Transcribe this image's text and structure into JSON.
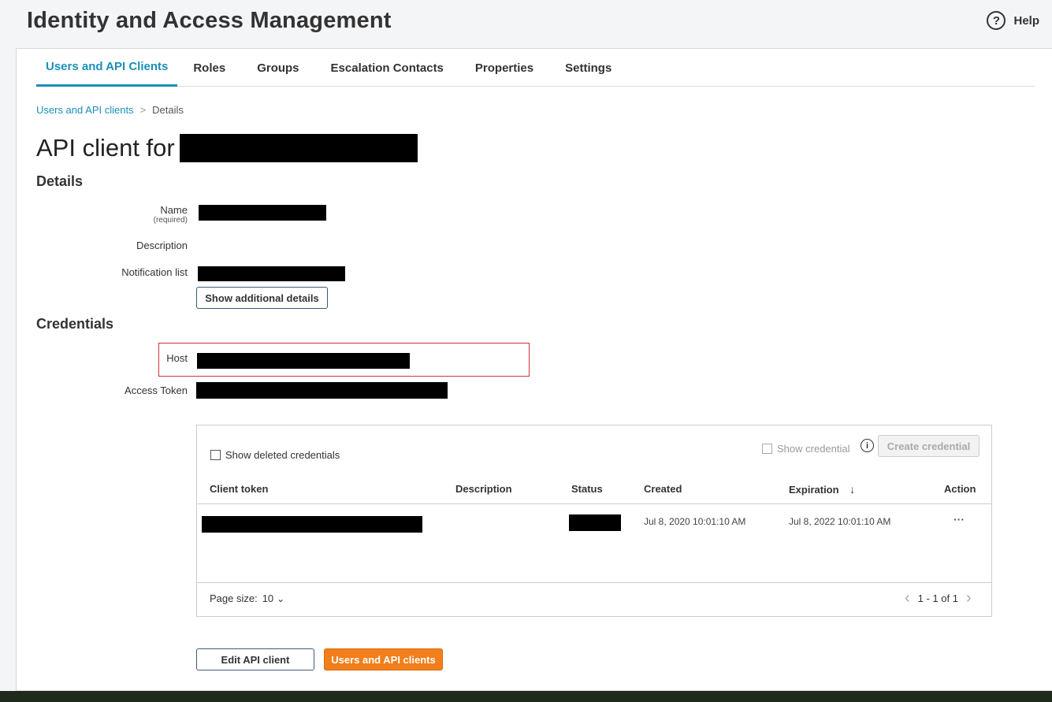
{
  "header": {
    "title": "Identity and Access Management",
    "help_label": "Help",
    "help_icon": "?"
  },
  "tabs": [
    {
      "label": "Users and API Clients",
      "active": true
    },
    {
      "label": "Roles"
    },
    {
      "label": "Groups"
    },
    {
      "label": "Escalation Contacts"
    },
    {
      "label": "Properties"
    },
    {
      "label": "Settings"
    }
  ],
  "breadcrumb": {
    "link": "Users and API clients",
    "separator": ">",
    "current": "Details"
  },
  "page_title": "API client for",
  "details": {
    "section_title": "Details",
    "name_label": "Name",
    "name_required": "(required)",
    "description_label": "Description",
    "notification_label": "Notification list",
    "show_additional_button": "Show additional details"
  },
  "credentials": {
    "section_title": "Credentials",
    "host_label": "Host",
    "access_token_label": "Access Token",
    "show_deleted_label": "Show deleted credentials",
    "show_credential_label": "Show credential",
    "info_icon": "i",
    "create_button": "Create credential",
    "columns": [
      "Client token",
      "Description",
      "Status",
      "Created",
      "Expiration",
      "Action"
    ],
    "sort_arrow": "↓",
    "rows": [
      {
        "created": "Jul 8, 2020 10:01:10 AM",
        "expiration": "Jul 8, 2022 10:01:10 AM",
        "action": "···"
      }
    ],
    "page_size_label": "Page size:",
    "page_size_value": "10",
    "page_size_chevron": "⌄",
    "pagination": "1 - 1 of 1",
    "prev": "‹",
    "next": "›"
  },
  "actions": {
    "edit_button": "Edit API client",
    "back_button": "Users and API clients"
  },
  "colors": {
    "accent": "#1a8fb8",
    "primary_button": "#f27f1b",
    "highlight_border": "#d0303a"
  }
}
